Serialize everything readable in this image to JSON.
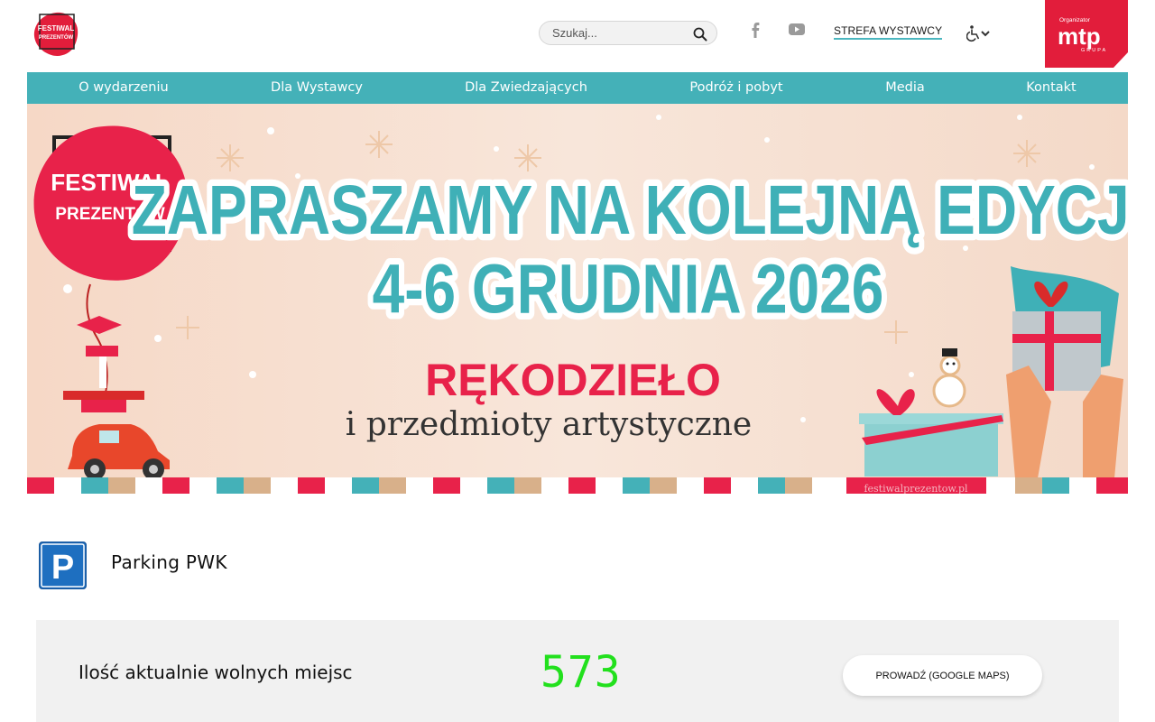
{
  "header": {
    "logo_text_line1": "FESTIWAL",
    "logo_text_line2": "PREZENTÓW",
    "search_placeholder": "Szukaj...",
    "exhibitor_zone_label": "STREFA WYSTAWCY",
    "organizer_label": "Organizator",
    "organizer_brand": "mtp",
    "organizer_sub": "GRUPA",
    "icons": [
      "search-icon",
      "facebook-icon",
      "youtube-icon",
      "accessibility-icon",
      "chevron-down-icon"
    ]
  },
  "nav": {
    "items": [
      {
        "label": "O wydarzeniu"
      },
      {
        "label": "Dla Wystawcy"
      },
      {
        "label": "Dla Zwiedzających"
      },
      {
        "label": "Podróż i pobyt"
      },
      {
        "label": "Media"
      },
      {
        "label": "Kontakt"
      }
    ]
  },
  "banner": {
    "logo_line1": "FESTIWAL",
    "logo_line2": "PREZENTÓW",
    "headline": "ZAPRASZAMY NA KOLEJNĄ EDYCJĘ",
    "dates": "4-6 GRUDNIA 2026",
    "category": "RĘKODZIEŁO",
    "subtitle": "i przedmioty artystyczne",
    "url": "festiwalprezentow.pl"
  },
  "parking": {
    "icon_letter": "P",
    "title": "Parking PWK",
    "free_spaces_label": "Ilość aktualnie wolnych miejsc",
    "free_spaces_count": "573",
    "navigate_button": "PROWADŹ (GOOGLE MAPS)"
  },
  "colors": {
    "nav_bg": "#44b1b8",
    "brand_red": "#e21d3b",
    "teal_text": "#3fb0b7",
    "count_green": "#22e01d",
    "parking_blue": "#1e6fc0"
  }
}
